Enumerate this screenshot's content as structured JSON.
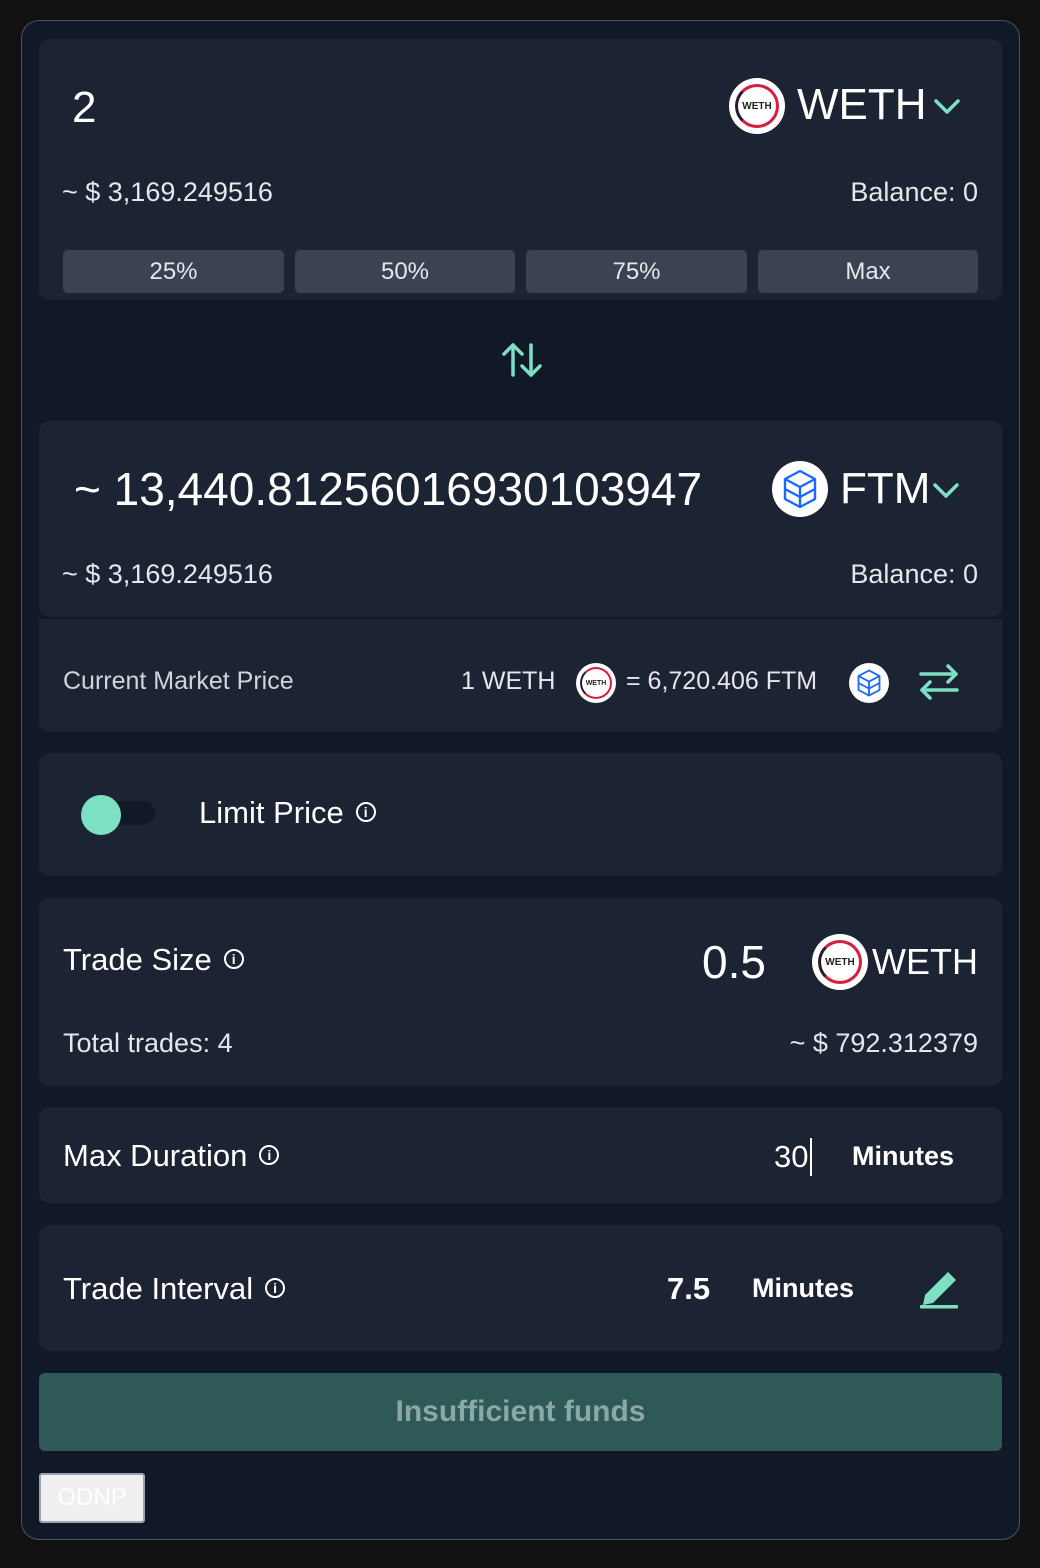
{
  "from": {
    "amount": "2",
    "usd": "~ $ 3,169.249516",
    "balance": "Balance: 0",
    "token": {
      "symbol": "WETH",
      "logo_text": "WETH"
    },
    "percent_buttons": [
      "25%",
      "50%",
      "75%",
      "Max"
    ]
  },
  "to": {
    "amount": "~ 13,440.81256016930103947",
    "usd": "~ $ 3,169.249516",
    "balance": "Balance: 0",
    "token": {
      "symbol": "FTM"
    }
  },
  "market": {
    "label": "Current Market Price",
    "base": "1 WETH",
    "base_logo_text": "WETH",
    "quote": "= 6,720.406 FTM"
  },
  "limit": {
    "label": "Limit Price",
    "enabled": false
  },
  "trade_size": {
    "label": "Trade Size",
    "value": "0.5",
    "token": "WETH",
    "logo_text": "WETH",
    "total": "Total trades: 4",
    "usd": "~ $ 792.312379"
  },
  "duration": {
    "label": "Max Duration",
    "value": "30",
    "unit": "Minutes"
  },
  "interval": {
    "label": "Trade Interval",
    "value": "7.5",
    "unit": "Minutes"
  },
  "submit": {
    "label": "Insufficient funds"
  },
  "footer_button": {
    "label": "ODNP"
  },
  "colors": {
    "accent": "#7ee0c3",
    "weth_red": "#d81e3c",
    "ftm_blue": "#1969ff",
    "submit_bg": "#2e5957"
  },
  "icons": {
    "swap": "swap-vertical-icon",
    "chevron": "chevron-down-icon",
    "invert": "swap-horizontal-icon",
    "info": "info-icon",
    "edit": "pencil-icon"
  }
}
